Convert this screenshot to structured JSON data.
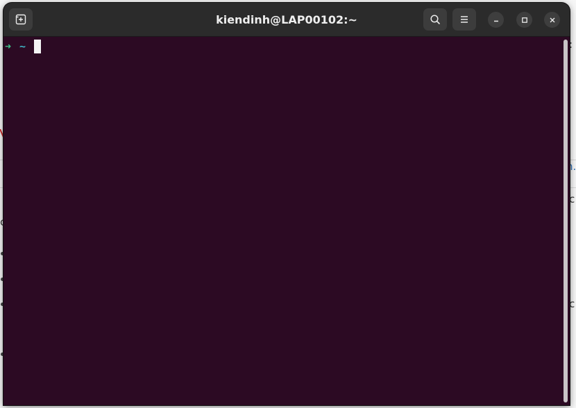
{
  "window": {
    "title": "kiendinh@LAP00102:~"
  },
  "headerbar": {
    "new_tab_icon": "new-tab-icon",
    "search_icon": "search-icon",
    "menu_icon": "hamburger-menu-icon",
    "minimize_icon": "minimize-icon",
    "maximize_icon": "maximize-icon",
    "close_icon": "close-icon"
  },
  "terminal": {
    "prompt_symbol": "➜",
    "prompt_dir": "~",
    "input": ""
  },
  "background_page": {
    "fragments": [
      ":",
      "n.",
      "c",
      "c",
      "c"
    ]
  },
  "colors": {
    "terminal_bg": "#2c0a23",
    "headerbar_bg": "#2b2b2b",
    "prompt_arrow": "#3fc48a",
    "prompt_dir": "#3fb3c4",
    "cursor": "#f4f4f4"
  }
}
